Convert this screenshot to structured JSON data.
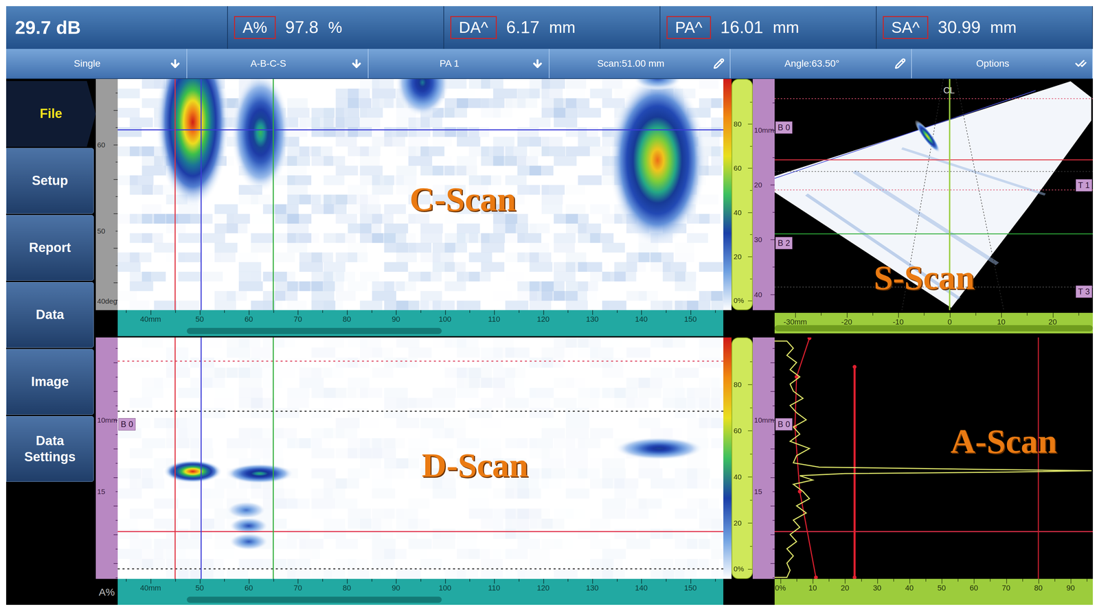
{
  "header": {
    "gain": "29.7 dB",
    "readings": [
      {
        "label": "A%",
        "value": "97.8",
        "unit": "%"
      },
      {
        "label": "DA^",
        "value": "6.17",
        "unit": "mm"
      },
      {
        "label": "PA^",
        "value": "16.01",
        "unit": "mm"
      },
      {
        "label": "SA^",
        "value": "30.99",
        "unit": "mm"
      }
    ]
  },
  "toolbar": [
    {
      "label": "Single",
      "kind": "dropdown"
    },
    {
      "label": "A-B-C-S",
      "kind": "dropdown"
    },
    {
      "label": "PA 1",
      "kind": "dropdown"
    },
    {
      "label": "Scan:51.00 mm",
      "kind": "edit"
    },
    {
      "label": "Angle:63.50°",
      "kind": "edit"
    },
    {
      "label": "Options",
      "kind": "options"
    }
  ],
  "sidebar": [
    {
      "label": "File",
      "selected": true
    },
    {
      "label": "Setup",
      "selected": false
    },
    {
      "label": "Report",
      "selected": false
    },
    {
      "label": "Data",
      "selected": false
    },
    {
      "label": "Image",
      "selected": false
    },
    {
      "label": "Data Settings",
      "selected": false
    }
  ],
  "color_scale": {
    "ticks": [
      "80",
      "60",
      "40",
      "20",
      "0%"
    ]
  },
  "c_scan": {
    "title": "C-Scan",
    "x_ticks": [
      "40mm",
      "50",
      "60",
      "70",
      "80",
      "90",
      "100",
      "110",
      "120",
      "130",
      "140",
      "150"
    ],
    "y_ticks": [
      "60",
      "50",
      "40deg"
    ],
    "scrollbar": {
      "start": 0.114,
      "end": 0.535
    },
    "cursors": {
      "reference_mm": 45.0,
      "measure_mm": 50.3,
      "data_mm": 65.0,
      "angle_deg": 61.7
    },
    "indications": [
      {
        "scan_mm": 48.6,
        "angle_deg": 62.6,
        "amplitude_pct": 98,
        "length_mm": 7.5,
        "height_deg": 10
      },
      {
        "scan_mm": 62.4,
        "angle_deg": 61.4,
        "amplitude_pct": 64,
        "length_mm": 6,
        "height_deg": 7
      },
      {
        "scan_mm": 95.4,
        "angle_deg": 67.2,
        "amplitude_pct": 55,
        "length_mm": 5.5,
        "height_deg": 4
      },
      {
        "scan_mm": 143.3,
        "angle_deg": 58.2,
        "amplitude_pct": 89,
        "length_mm": 10,
        "height_deg": 10
      },
      {
        "scan_mm": 143.3,
        "angle_deg": 67.8,
        "amplitude_pct": 40,
        "length_mm": 5,
        "height_deg": 1.5
      }
    ]
  },
  "s_scan": {
    "title": "S-Scan",
    "depth_ticks": [
      "10mm",
      "20",
      "30",
      "40"
    ],
    "x_ticks": [
      "-30mm",
      "-20",
      "-10",
      "0",
      "10",
      "20"
    ],
    "centerline": "CL",
    "scrollbar": {
      "start": 0.0,
      "end": 1.0
    },
    "badges": [
      {
        "label": "B 0",
        "side": "left"
      },
      {
        "label": "T 1",
        "side": "right"
      },
      {
        "label": "B 2",
        "side": "left"
      },
      {
        "label": "T 3",
        "side": "right"
      }
    ],
    "indications": [
      {
        "offset_mm": -4.3,
        "depth_mm": 11.2,
        "amplitude_pct": 80
      }
    ]
  },
  "d_scan": {
    "title": "D-Scan",
    "x_ticks": [
      "40mm",
      "50",
      "60",
      "70",
      "80",
      "90",
      "100",
      "110",
      "120",
      "130",
      "140",
      "150"
    ],
    "depth_ticks": [
      "10mm",
      "15"
    ],
    "badge": "B 0",
    "scrollbar": {
      "start": 0.114,
      "end": 0.535
    },
    "depth_lines": [
      {
        "depth_mm": 5.9,
        "style": "dotted",
        "color": "#e0506a"
      },
      {
        "depth_mm": 9.4,
        "style": "dotted",
        "color": "#333333"
      },
      {
        "depth_mm": 17.8,
        "style": "solid",
        "color": "#e0304a"
      },
      {
        "depth_mm": 20.4,
        "style": "dotted",
        "color": "#333333"
      }
    ],
    "indications": [
      {
        "scan_mm": 48.6,
        "depth_mm": 13.6,
        "amplitude_pct": 97,
        "length_mm": 6,
        "height_mm": 0.8
      },
      {
        "scan_mm": 62.2,
        "depth_mm": 13.75,
        "amplitude_pct": 62,
        "length_mm": 7,
        "height_mm": 0.7
      },
      {
        "scan_mm": 143.6,
        "depth_mm": 12.0,
        "amplitude_pct": 50,
        "length_mm": 9,
        "height_mm": 0.8
      },
      {
        "scan_mm": 59.5,
        "depth_mm": 16.3,
        "amplitude_pct": 32,
        "length_mm": 4,
        "height_mm": 0.6
      },
      {
        "scan_mm": 60.0,
        "depth_mm": 17.4,
        "amplitude_pct": 38,
        "length_mm": 4,
        "height_mm": 0.6
      },
      {
        "scan_mm": 60.0,
        "depth_mm": 18.5,
        "amplitude_pct": 36,
        "length_mm": 4,
        "height_mm": 0.6
      }
    ]
  },
  "a_scan": {
    "title": "A-Scan",
    "x_ticks": [
      "0%",
      "10",
      "20",
      "30",
      "40",
      "50",
      "60",
      "70",
      "80",
      "90"
    ],
    "badge": "B 0",
    "trace": {
      "depth_mm": [
        4.5,
        5.0,
        5.5,
        6.0,
        6.5,
        7.0,
        7.5,
        8.0,
        8.5,
        9.0,
        9.5,
        10.0,
        10.5,
        11.0,
        11.5,
        12.0,
        12.5,
        13.0,
        13.3,
        13.45,
        13.55,
        13.65,
        13.75,
        13.9,
        14.2,
        14.5,
        15.0,
        15.5,
        16.0,
        16.5,
        17.0,
        17.5,
        18.0,
        18.5,
        19.0,
        19.5,
        20.0,
        20.5,
        21.0
      ],
      "amplitude_pct": [
        2,
        4,
        2,
        5,
        3,
        6,
        3,
        4,
        7,
        3,
        5,
        8,
        4,
        6,
        3,
        9,
        5,
        4,
        12,
        60,
        97.8,
        70,
        20,
        6,
        10,
        4,
        7,
        9,
        5,
        8,
        4,
        6,
        3,
        5,
        2,
        4,
        2,
        3,
        2
      ]
    },
    "gate": {
      "level_pct": 23,
      "start_mm": 6.3,
      "end_mm": 21.0
    },
    "reference_pct": 80,
    "tcg": {
      "depth_mm": [
        4.3,
        7.0,
        10.5,
        15.0,
        21.0
      ],
      "amplitude_pct": [
        9,
        5,
        4.5,
        6,
        11
      ]
    }
  },
  "amplitude_axis_label": "A%"
}
